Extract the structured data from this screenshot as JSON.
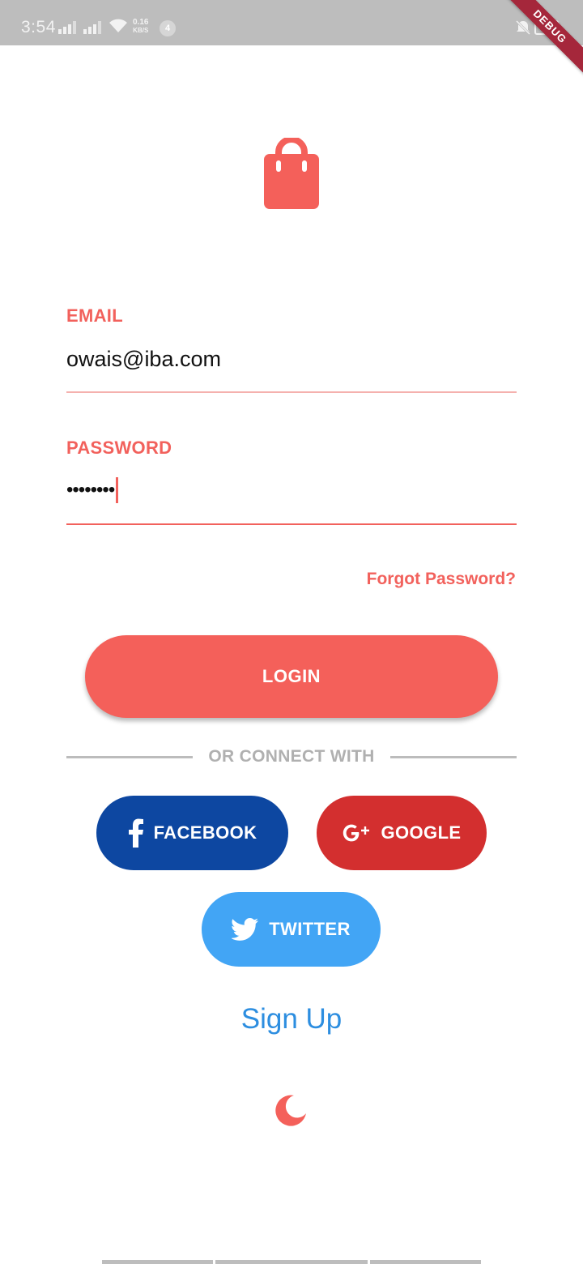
{
  "status_bar": {
    "time": "3:54",
    "net_speed_value": "0.16",
    "net_speed_unit": "KB/S",
    "notification_count": "4",
    "battery_level": "100",
    "debug_label": "DEBUG"
  },
  "login_form": {
    "email_label": "EMAIL",
    "email_value": "owais@iba.com",
    "password_label": "PASSWORD",
    "password_masked": "••••••••",
    "forgot_password": "Forgot Password?",
    "login_button": "LOGIN"
  },
  "social": {
    "divider_text": "OR CONNECT WITH",
    "facebook_label": "FACEBOOK",
    "google_label": "GOOGLE",
    "twitter_label": "TWITTER"
  },
  "footer": {
    "signup_label": "Sign Up"
  },
  "icons": {
    "logo": "shopping-bag-icon",
    "theme_toggle": "moon-icon",
    "facebook": "facebook-icon",
    "google": "google-plus-icon",
    "twitter": "twitter-icon"
  },
  "colors": {
    "accent": "#f4605a",
    "facebook": "#0d47a1",
    "google": "#d32f2f",
    "twitter": "#42a5f5",
    "link": "#2d8ee0",
    "status_bar": "#bdbdbd"
  }
}
